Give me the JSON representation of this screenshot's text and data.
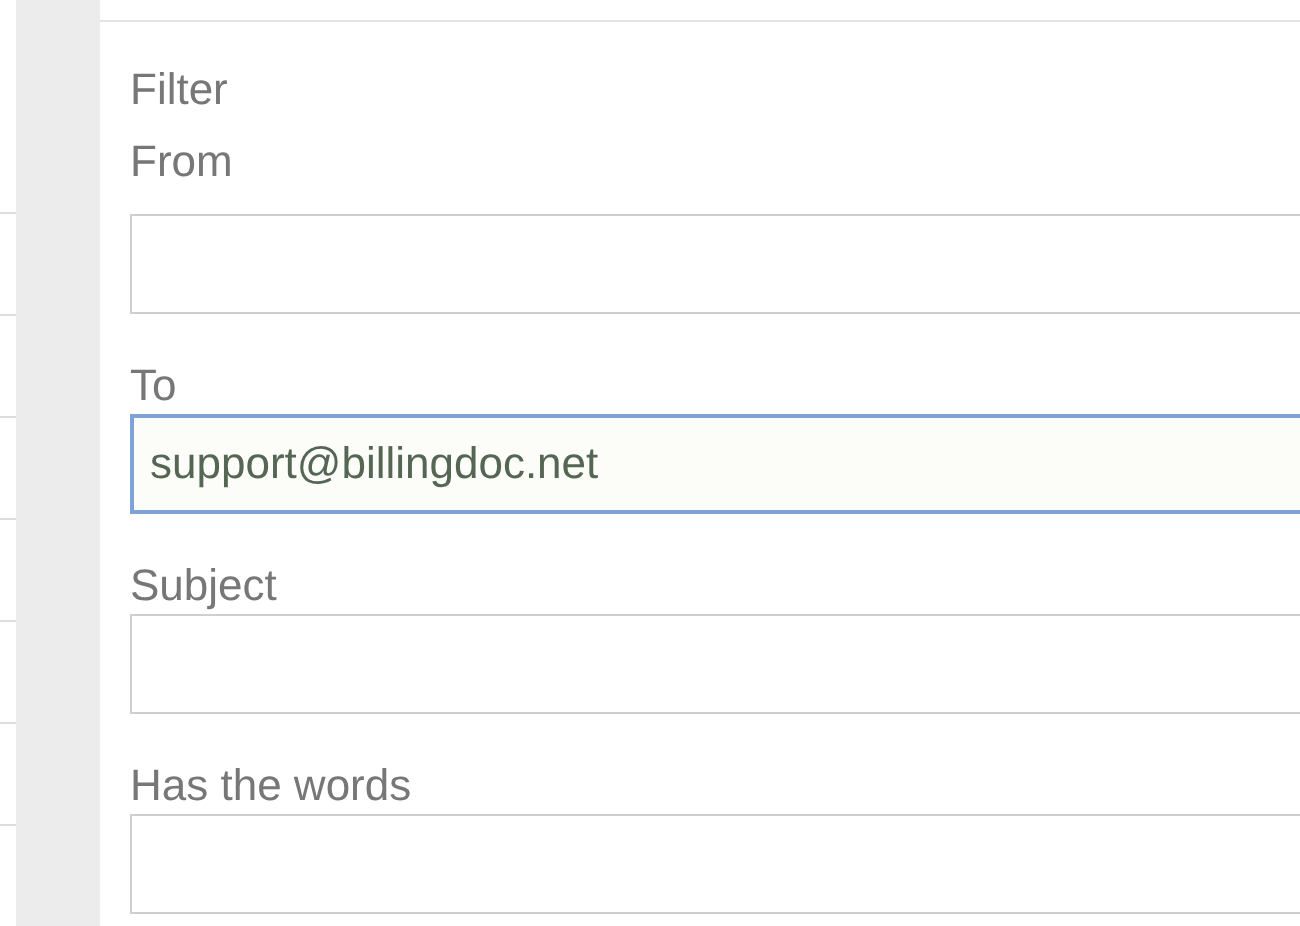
{
  "panel": {
    "title": "Filter"
  },
  "fields": [
    {
      "label": "From",
      "focused": false
    },
    {
      "label": "To",
      "value": "support@billingdoc.net",
      "focused": true
    },
    {
      "label": "Subject",
      "focused": false
    },
    {
      "label": "Has the words",
      "focused": false
    }
  ]
}
